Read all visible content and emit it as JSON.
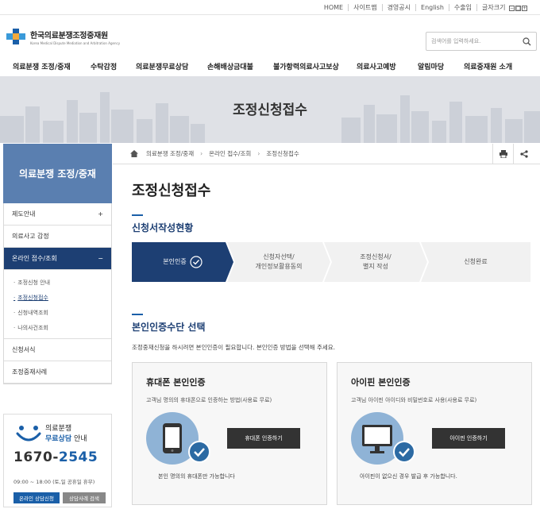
{
  "util_links": [
    "HOME",
    "사이트맵",
    "경영공시",
    "English",
    "수출입",
    "글자크기"
  ],
  "logo": {
    "name": "한국의료분쟁조정중재원",
    "sub": "Korea Medical Dispute Mediation and Arbitration Agency"
  },
  "search": {
    "placeholder": "검색어를 입력하세요."
  },
  "gnb": [
    "의료분쟁 조정/중재",
    "수탁감정",
    "의료분쟁무료상담",
    "손해배상금대불",
    "불가항력의료사고보상",
    "의료사고예방",
    "알림마당",
    "의료중재원 소개"
  ],
  "banner_title": "조정신청접수",
  "sidebar": {
    "title": "의료분쟁 조정/중재",
    "items": [
      {
        "label": "제도안내",
        "toggle": "+"
      },
      {
        "label": "의료사고 감정",
        "toggle": ""
      },
      {
        "label": "온라인 접수/조회",
        "toggle": "−"
      }
    ],
    "subs": [
      "조정신청 안내",
      "조정신청접수",
      "신청내역조회",
      "나의사건조회"
    ],
    "items_after": [
      {
        "label": "신청서식"
      },
      {
        "label": "조정중재사례"
      }
    ]
  },
  "consult": {
    "line1": "의료분쟁",
    "line2_em": "무료상담",
    "line2_rest": " 안내",
    "phone_a": "1670-",
    "phone_b": "2545",
    "hours": "09:00 ~ 18:00 (토,일 공휴일 휴무)",
    "btn1": "온라인 상담신청",
    "btn2": "상담사례 검색"
  },
  "breadcrumb": [
    "의료분쟁 조정/중재",
    "온라인 접수/조회",
    "조정신청접수"
  ],
  "page_title": "조정신청접수",
  "section1": "신청서작성현황",
  "steps": [
    {
      "label": "본인인증",
      "active": true
    },
    {
      "label": "신청자선택/\n개인정보활용동의",
      "active": false
    },
    {
      "label": "조정신청서/\n별지 작성",
      "active": false
    },
    {
      "label": "신청완료",
      "active": false
    }
  ],
  "section2": "본인인증수단 선택",
  "description": "조정중재신청을 하시려면 본인인증이 필요합니다. 본인인증 방법을 선택해 주세요.",
  "cards": [
    {
      "title": "휴대폰 본인인증",
      "desc": "고객님 명의의 휴대폰으로 인증하는 방법(사용료 무료)",
      "button": "휴대폰 인증하기",
      "note": "본인 명의의 휴대폰만 가능합니다"
    },
    {
      "title": "아이핀 본인인증",
      "desc": "고객님 아이핀 아이디와 비밀번호로 사용(사용료 무료)",
      "button": "아이핀 인증하기",
      "note": "아이핀이 없으신 경우 발급 후 가능합니다."
    }
  ],
  "colors": {
    "primary": "#1d3f73",
    "accent": "#1a5fa8",
    "sidebar_head": "#5a7fb0"
  }
}
